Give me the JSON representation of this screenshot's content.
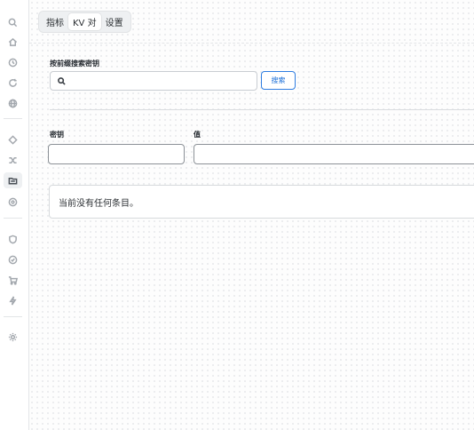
{
  "tabs": [
    {
      "label": "指标",
      "active": false
    },
    {
      "label": "KV 对",
      "active": true
    },
    {
      "label": "设置",
      "active": false
    }
  ],
  "search": {
    "label": "按前缀搜索密钥",
    "placeholder": "",
    "value": "",
    "button_label": "搜索"
  },
  "form": {
    "key_label": "密钥",
    "key_value": "",
    "value_label": "值",
    "value_value": ""
  },
  "entries": {
    "empty_message": "当前没有任何条目。"
  },
  "colors": {
    "accent": "#2f7de1",
    "border": "#c9cdd2",
    "sidebar_icon": "#a3a8ae"
  },
  "sidebar": {
    "items": [
      {
        "icon": "search-icon"
      },
      {
        "icon": "home-icon"
      },
      {
        "icon": "history-icon"
      },
      {
        "icon": "refresh-icon"
      },
      {
        "icon": "globe-icon"
      },
      {
        "icon": "diamond-icon"
      },
      {
        "icon": "shuffle-icon"
      },
      {
        "icon": "folder-icon",
        "active": true
      },
      {
        "icon": "settings-circle-icon"
      },
      {
        "icon": "shield-icon"
      },
      {
        "icon": "shield-check-icon"
      },
      {
        "icon": "cart-icon"
      },
      {
        "icon": "bolt-icon"
      },
      {
        "icon": "gear-icon"
      }
    ]
  }
}
